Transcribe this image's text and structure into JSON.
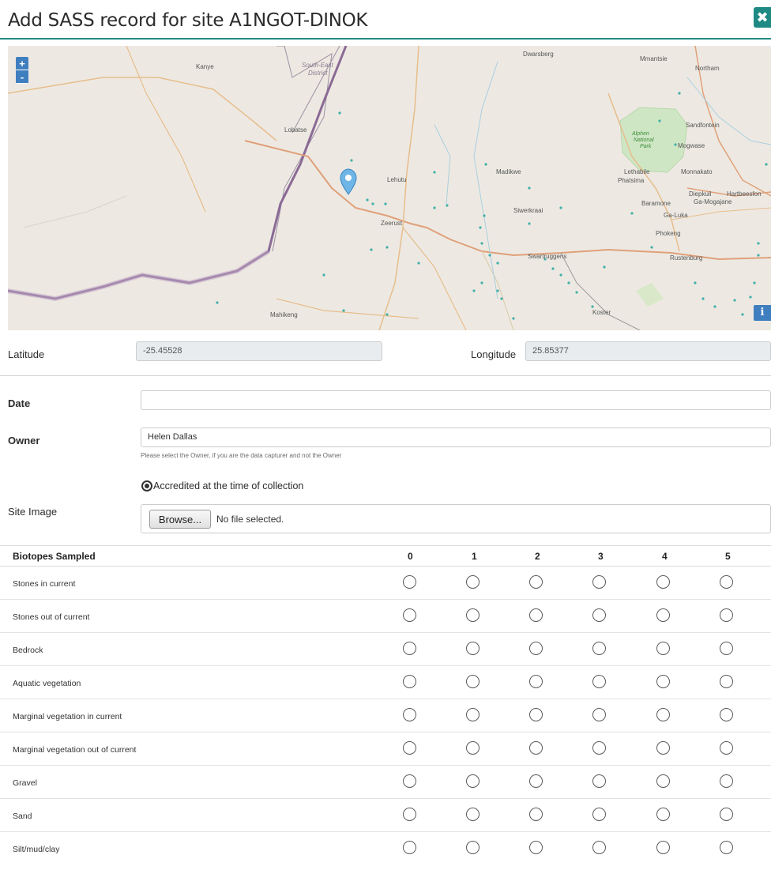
{
  "header": {
    "title": "Add SASS record for site A1NGOT-DINOK",
    "close_icon": "✖"
  },
  "map": {
    "zoom_in": "+",
    "zoom_out": "-",
    "info": "i",
    "labels": {
      "kanye": "Kanye",
      "south_east": "South-East",
      "district": "District",
      "lobatse": "Lobatse",
      "dwarsberg": "Dwarsberg",
      "mmantsie": "Mmantsie",
      "northam": "Northam",
      "sandfontein": "Sandfontein",
      "alphen": "Alphen",
      "alphen2": "National",
      "alphen3": "Park",
      "mogwase": "Mogwase",
      "lehurutshe": "Lehutu",
      "madikwe": "Madikwe",
      "lethlabile": "Lethabile",
      "phatsima": "Phatsima",
      "monnakato": "Monnakato",
      "diepkuil": "Diepkuil",
      "hartbees": "Hartbeesfon",
      "mamogaleskraal": "Ga-Mogajane",
      "baramone": "Baramone",
      "galuka": "Ga-Luka",
      "phokeng": "Phokeng",
      "zeerust": "Zeerust",
      "swartruggens": "Swartruggens",
      "siwerkraai": "Siwerkraai",
      "rustenburg": "Rustenburg",
      "mahikeng": "Mahikeng",
      "koster": "Koster"
    }
  },
  "form": {
    "latitude_label": "Latitude",
    "latitude_value": "-25.45528",
    "longitude_label": "Longitude",
    "longitude_value": "25.85377",
    "date_label": "Date",
    "date_value": "",
    "owner_label": "Owner",
    "owner_value": "Helen Dallas",
    "owner_help": "Please select the Owner, if you are the data capturer and not the Owner",
    "accredited_label": "Accredited at the time of collection",
    "site_image_label": "Site Image",
    "browse_label": "Browse...",
    "file_status": "No file selected."
  },
  "biotopes": {
    "header": "Biotopes Sampled",
    "columns": [
      "0",
      "1",
      "2",
      "3",
      "4",
      "5"
    ],
    "rows": [
      "Stones in current",
      "Stones out of current",
      "Bedrock",
      "Aquatic vegetation",
      "Marginal vegetation in current",
      "Marginal vegetation out of current",
      "Gravel",
      "Sand",
      "Silt/mud/clay"
    ]
  }
}
